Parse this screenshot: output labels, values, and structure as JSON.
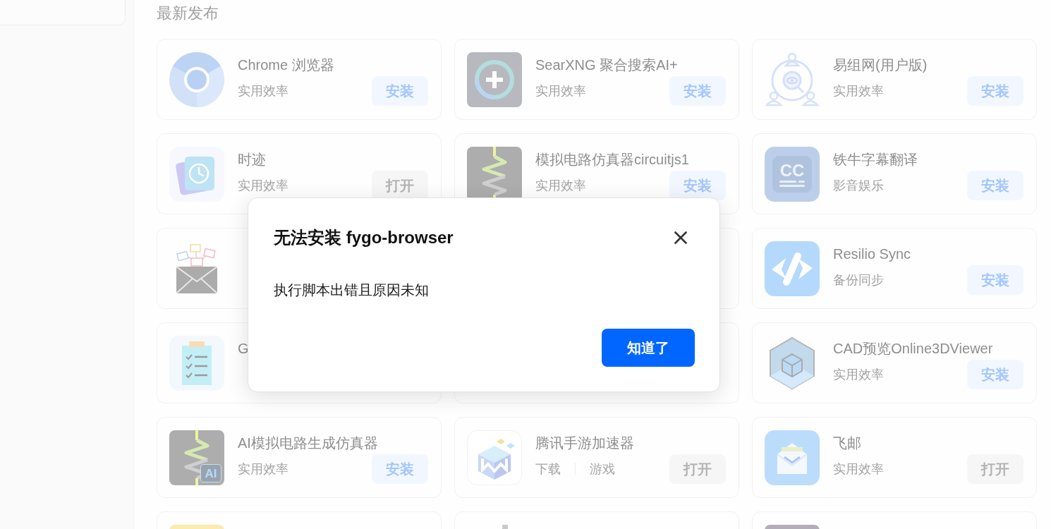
{
  "section_title": "最新发布",
  "cards": [
    {
      "kind": "app",
      "name": "Chrome 浏览器",
      "tags": [
        "实用效率"
      ],
      "action": {
        "label": "安装",
        "kind": "install"
      }
    },
    {
      "kind": "app",
      "name": "SearXNG 聚合搜索AI+",
      "tags": [
        "实用效率"
      ],
      "action": {
        "label": "安装",
        "kind": "install"
      }
    },
    {
      "kind": "app",
      "name": "易组网(用户版)",
      "tags": [
        "实用效率"
      ],
      "action": {
        "label": "安装",
        "kind": "install"
      }
    },
    {
      "kind": "app",
      "name": "时迹",
      "tags": [
        "实用效率"
      ],
      "action": {
        "label": "打开",
        "kind": "open"
      }
    },
    {
      "kind": "app",
      "name": "模拟电路仿真器circuitjs1",
      "tags": [
        "实用效率"
      ],
      "action": {
        "label": "安装",
        "kind": "install"
      }
    },
    {
      "kind": "app",
      "name": "铁牛字幕翻译",
      "icon_text": "CC",
      "tags": [
        "影音娱乐"
      ],
      "action": {
        "label": "安装",
        "kind": "install"
      }
    },
    {
      "kind": "app"
    },
    {
      "kind": "hidden"
    },
    {
      "kind": "app",
      "name": "Resilio Sync",
      "tags": [
        "备份同步"
      ],
      "action": {
        "label": "安装",
        "kind": "install"
      }
    },
    {
      "kind": "app",
      "name": "G"
    },
    {
      "kind": "hidden"
    },
    {
      "kind": "app",
      "name": "CAD预览Online3DViewer",
      "tags": [
        "实用效率"
      ],
      "action": {
        "label": "安装",
        "kind": "install"
      }
    },
    {
      "kind": "app",
      "name": "AI模拟电路生成仿真器",
      "icon_text": "AI",
      "tags": [
        "实用效率"
      ],
      "action": {
        "label": "安装",
        "kind": "install"
      }
    },
    {
      "kind": "app",
      "name": "腾讯手游加速器",
      "tags": [
        "下载",
        "游戏"
      ],
      "action": {
        "label": "打开",
        "kind": "open"
      }
    },
    {
      "kind": "app",
      "name": "飞邮",
      "tags": [
        "实用效率"
      ],
      "action": {
        "label": "打开",
        "kind": "open"
      }
    },
    {
      "kind": "app"
    },
    {
      "kind": "app"
    },
    {
      "kind": "app"
    }
  ],
  "dialog": {
    "title": "无法安装 fygo-browser",
    "message": "执行脚本出错且原因未知",
    "button": "知道了"
  }
}
